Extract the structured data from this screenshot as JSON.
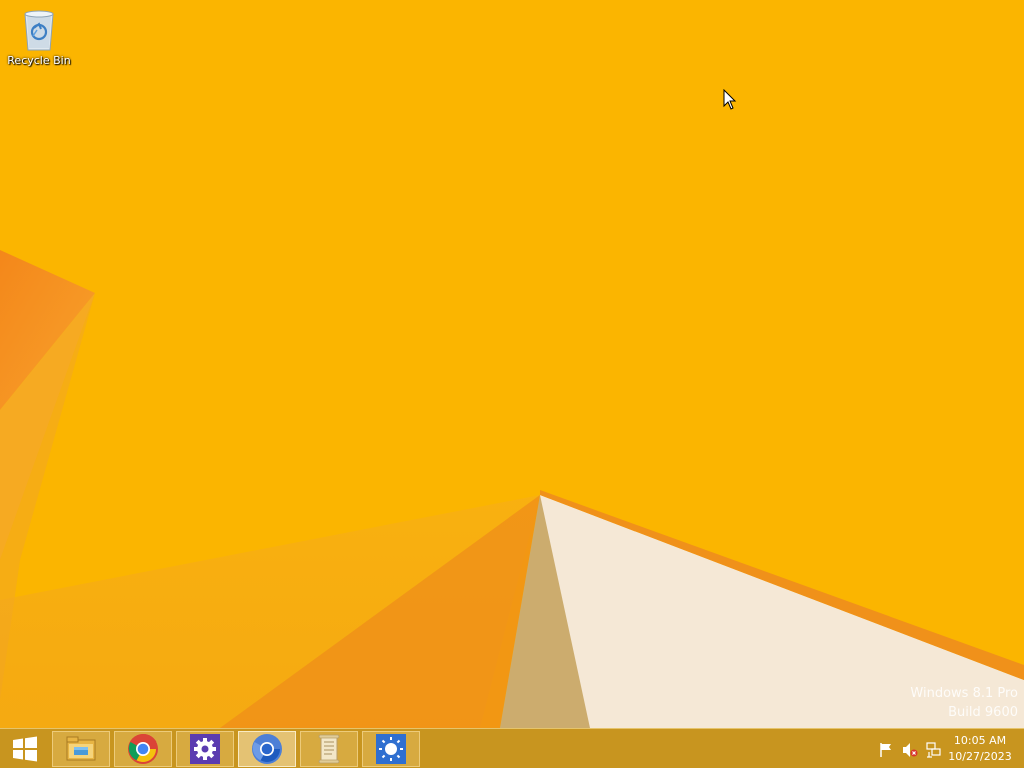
{
  "desktop": {
    "icons": [
      {
        "label": "Recycle Bin",
        "icon": "recycle-bin-icon"
      }
    ],
    "watermark": {
      "line1": "Windows 8.1 Pro",
      "line2": "Build 9600"
    },
    "colors": {
      "background": "#fbb500",
      "accent_orange": "#f08a12",
      "paper_white": "#f5e8d6"
    }
  },
  "taskbar": {
    "start_icon": "windows-logo-icon",
    "pinned": [
      {
        "name": "file-explorer",
        "icon": "folder-icon",
        "active": false
      },
      {
        "name": "chrome",
        "icon": "chrome-icon",
        "active": false
      },
      {
        "name": "settings",
        "icon": "gear-icon",
        "active": false
      },
      {
        "name": "chromium",
        "icon": "chromium-icon",
        "active": true
      },
      {
        "name": "notepad",
        "icon": "scroll-icon",
        "active": false
      },
      {
        "name": "brightness",
        "icon": "sun-icon",
        "active": false
      }
    ],
    "tray": {
      "icons": [
        "flag-icon",
        "speaker-muted-icon",
        "network-icon"
      ],
      "time": "10:05 AM",
      "date": "10/27/2023"
    }
  }
}
